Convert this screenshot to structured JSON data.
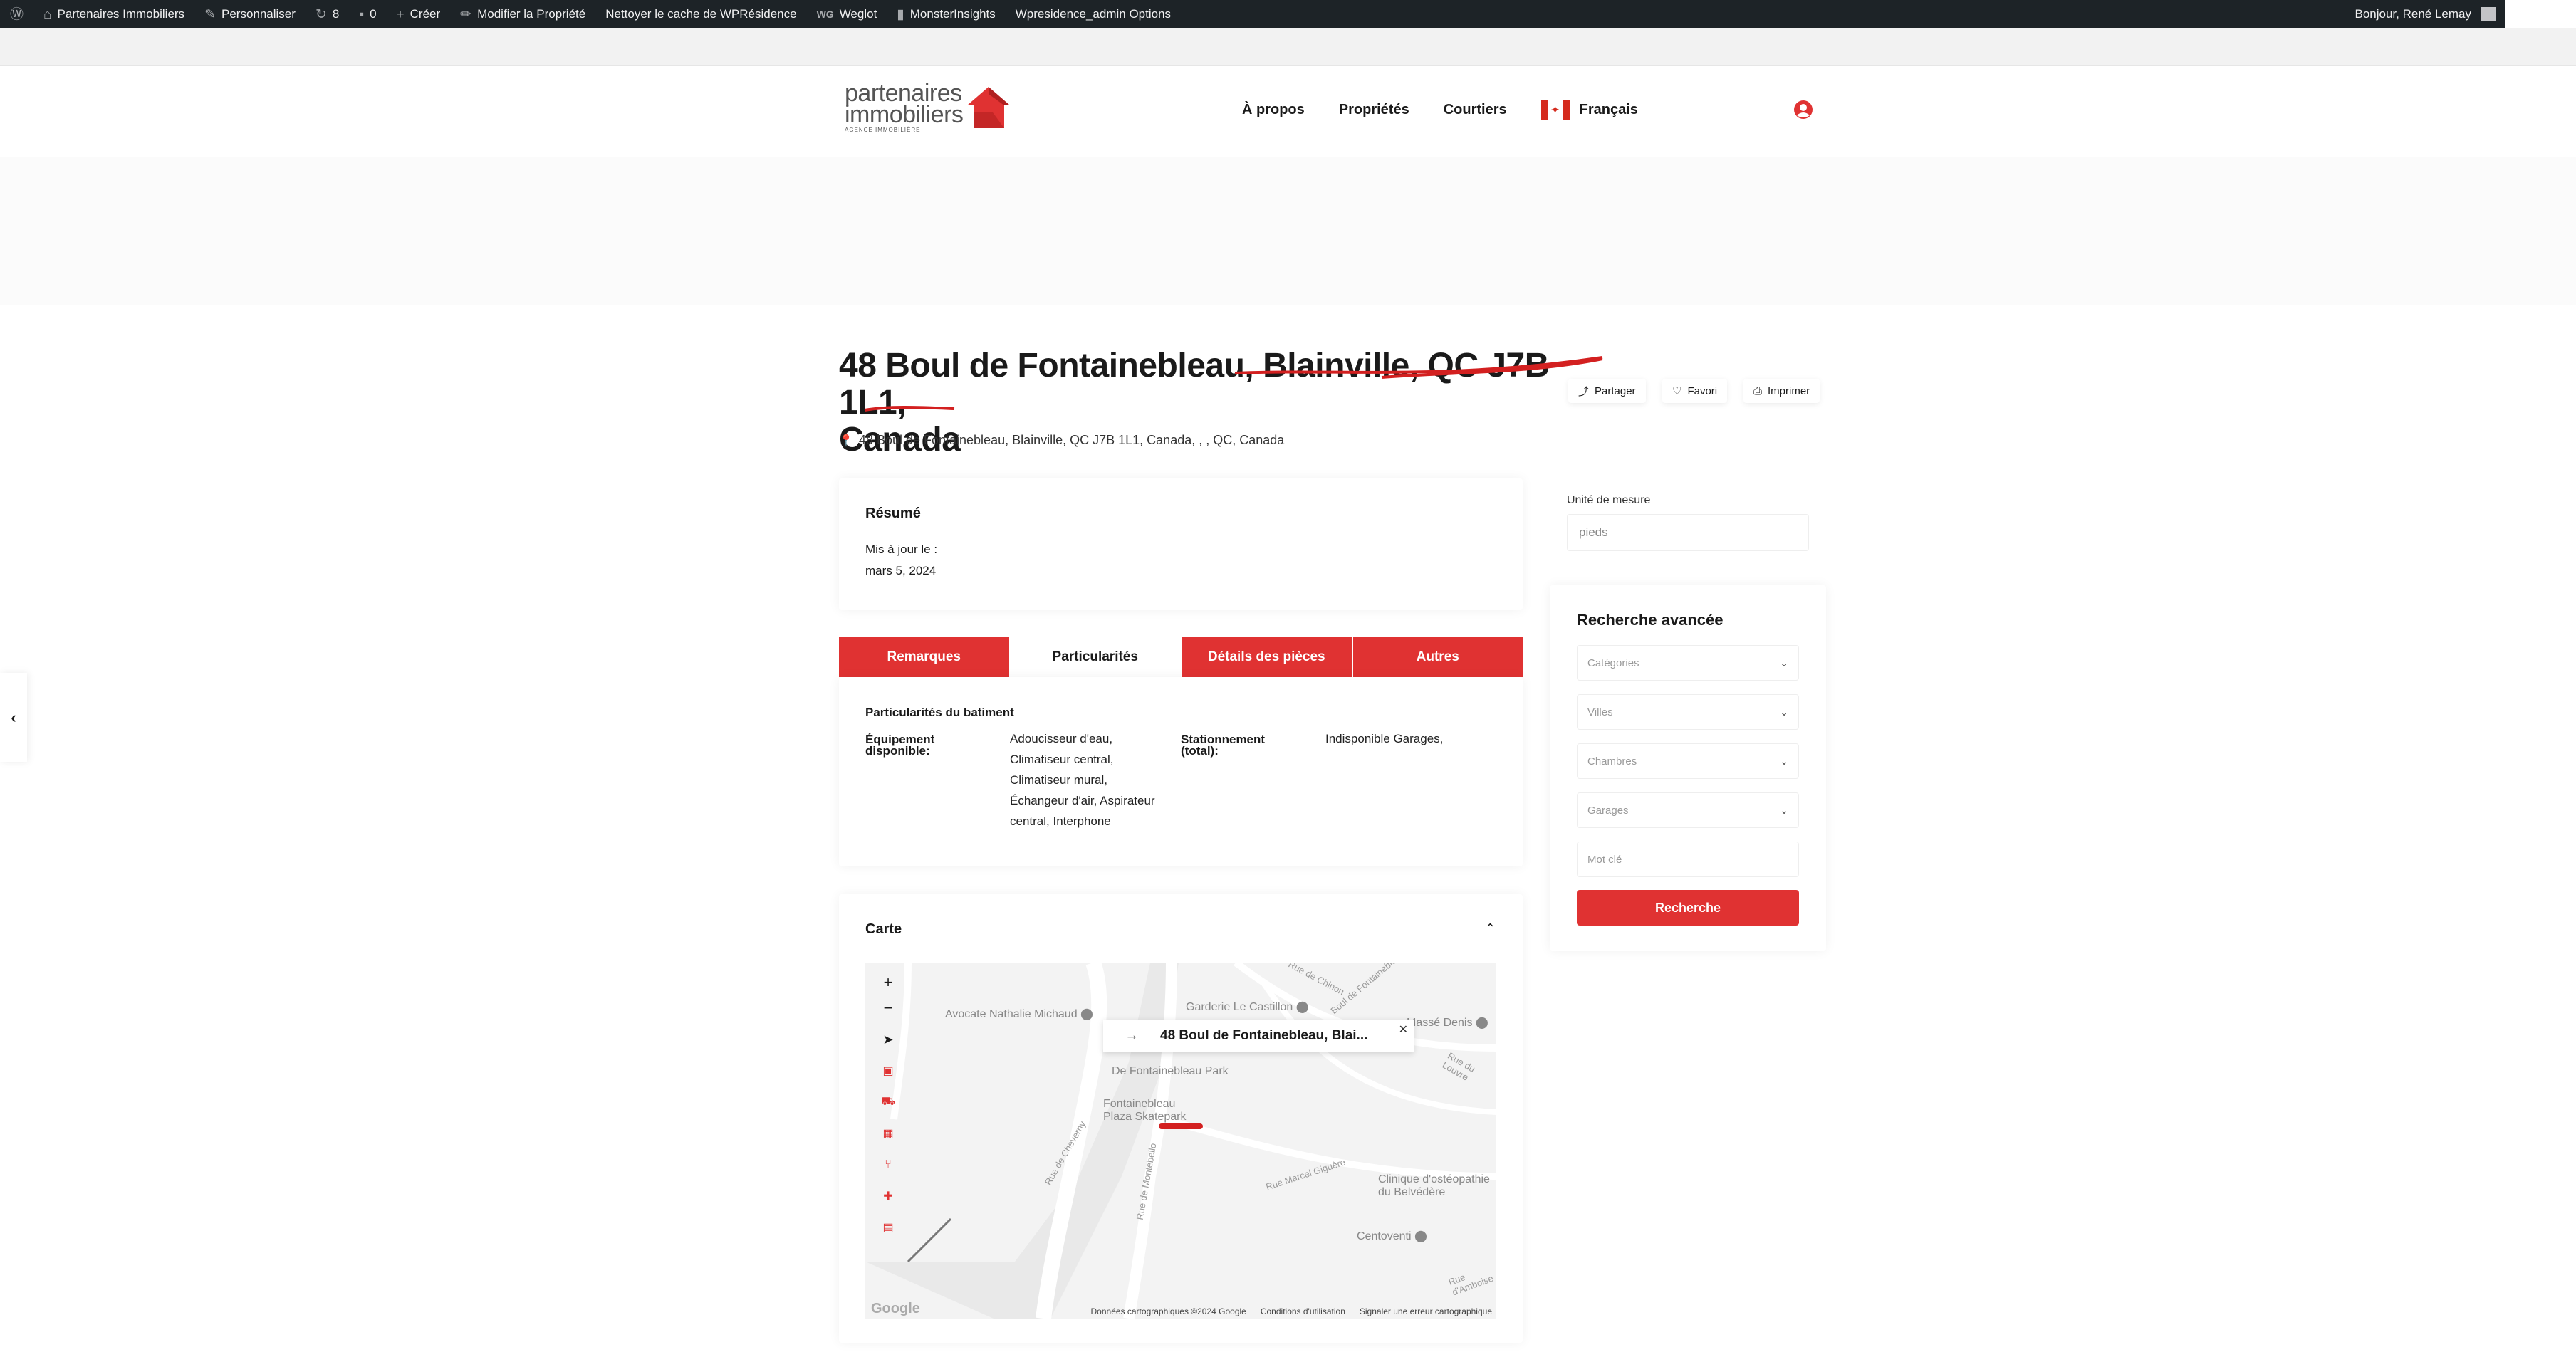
{
  "admin_bar": {
    "items": [
      {
        "icon": "wordpress-icon",
        "label": ""
      },
      {
        "icon": "dashboard-icon",
        "label": "Partenaires Immobiliers"
      },
      {
        "icon": "brush-icon",
        "label": "Personnaliser"
      },
      {
        "icon": "updates-icon",
        "label": "8"
      },
      {
        "icon": "comments-icon",
        "label": "0"
      },
      {
        "icon": "plus-icon",
        "label": "Créer"
      },
      {
        "icon": "pencil-icon",
        "label": "Modifier la Propriété"
      },
      {
        "icon": "",
        "label": "Nettoyer le cache de WPRésidence"
      },
      {
        "icon": "weglot-icon",
        "label": "Weglot"
      },
      {
        "icon": "chart-icon",
        "label": "MonsterInsights"
      },
      {
        "icon": "",
        "label": "Wpresidence_admin Options"
      }
    ],
    "greeting": "Bonjour, René Lemay"
  },
  "logo": {
    "line1": "partenaires",
    "line2": "immobiliers",
    "line3": "AGENCE IMMOBILIÈRE"
  },
  "nav": {
    "items": [
      "À propos",
      "Propriétés",
      "Courtiers"
    ],
    "language": "Français"
  },
  "property": {
    "title_line1": "48 Boul de Fontainebleau, Blainville, QC J7B 1L1,",
    "title_line2": "Canada",
    "address": "48 Boul de Fontainebleau, Blainville, QC J7B 1L1, Canada, , , QC, Canada"
  },
  "actions": {
    "share": "Partager",
    "favorite": "Favori",
    "print": "Imprimer"
  },
  "summary": {
    "heading": "Résumé",
    "updated_label": "Mis à jour le :",
    "updated_value": "mars 5, 2024"
  },
  "tabs": [
    {
      "label": "Remarques",
      "active": false
    },
    {
      "label": "Particularités",
      "active": true
    },
    {
      "label": "Détails des pièces",
      "active": false
    },
    {
      "label": "Autres",
      "active": false
    }
  ],
  "features": {
    "heading": "Particularités du batiment",
    "equipment_label": "Équipement disponible:",
    "equipment_lines": [
      "Adoucisseur d'eau,",
      "Climatiseur central,",
      "Climatiseur mural,",
      "Échangeur d'air, Aspirateur",
      "central, Interphone"
    ],
    "parking_label": "Stationnement (total):",
    "parking_value": "Indisponible Garages,"
  },
  "map": {
    "heading": "Carte",
    "popup_title": "48 Boul de Fontainebleau, Blai...",
    "places": [
      "Avocate Nathalie Michaud",
      "Garderie Le Castillon",
      "Massé Denis",
      "De Fontainebleau Park",
      "Fontainebleau Plaza Skatepark",
      "Clinique d'ostéopathie du Belvédère",
      "Centoventi"
    ],
    "streets": [
      "Rue de Chinon",
      "Rue du Louvre",
      "Rue de Cheverny",
      "Rue de Montebello",
      "Rue Marcel Giguère",
      "Rue d'Amboise",
      "Boul de Fontainebleau"
    ],
    "footer": [
      "Données cartographiques ©2024 Google",
      "Conditions d'utilisation",
      "Signaler une erreur cartographique"
    ],
    "provider": "Google"
  },
  "sidebar": {
    "measure_label": "Unité de mesure",
    "measure_value": "pieds",
    "search_heading": "Recherche avancée",
    "fields": [
      "Catégories",
      "Villes",
      "Chambres",
      "Garages"
    ],
    "keyword_placeholder": "Mot clé",
    "search_button": "Recherche"
  },
  "colors": {
    "accent": "#e03232",
    "admin_bar": "#1d2327"
  }
}
